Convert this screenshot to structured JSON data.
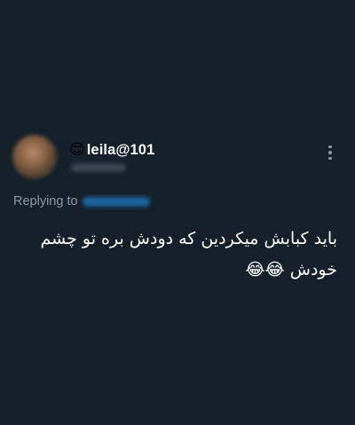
{
  "tweet": {
    "author": {
      "name_emoji": "😊",
      "display_name": "leila@101"
    },
    "replying_to_label": "Replying to",
    "text_line_1": "باید کبابش میکردین که دودش بره تو چشم",
    "text_line_2_words": "خودش",
    "text_line_2_emojis": "😂😂"
  }
}
